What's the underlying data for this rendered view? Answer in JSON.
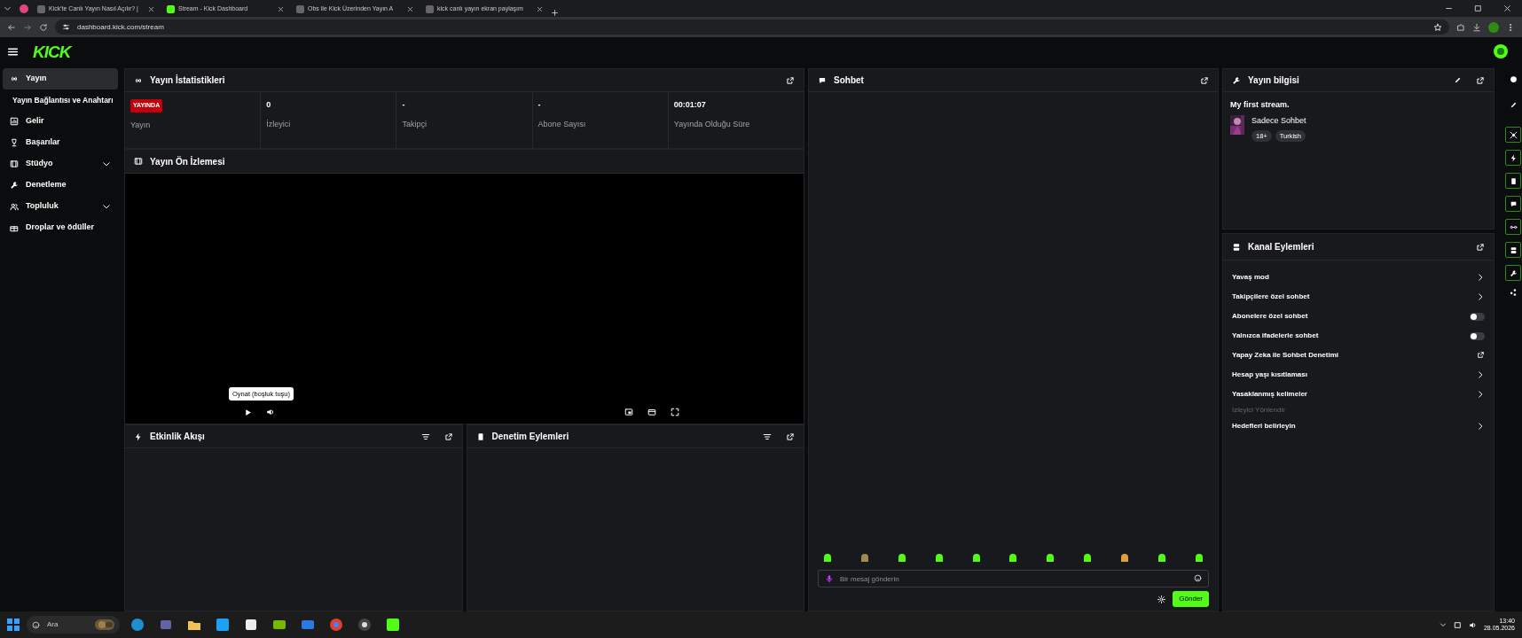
{
  "browser": {
    "tabs": [
      {
        "title": "Kick'te Canlı Yayın Nasıl Açılır? |",
        "selected": false
      },
      {
        "title": "Stream - Kick Dashboard",
        "selected": true
      },
      {
        "title": "Obs ile Kick Üzerinden Yayın A",
        "selected": false
      },
      {
        "title": "kick canlı yayın ekran paylaşım",
        "selected": false
      }
    ],
    "address": "dashboard.kick.com/stream"
  },
  "header": {
    "logo": "KICK"
  },
  "sidebar": {
    "items": [
      {
        "label": "Yayın",
        "kind": "item",
        "selected": true
      },
      {
        "label": "Yayın Bağlantısı ve Anahtarı",
        "kind": "subitem",
        "selected": false
      },
      {
        "label": "Gelir",
        "kind": "item",
        "selected": false
      },
      {
        "label": "Başarılar",
        "kind": "item",
        "selected": false
      },
      {
        "label": "Stüdyo",
        "kind": "group",
        "selected": false
      },
      {
        "label": "Denetleme",
        "kind": "item",
        "selected": false
      },
      {
        "label": "Topluluk",
        "kind": "group",
        "selected": false
      },
      {
        "label": "Droplar ve ödüller",
        "kind": "item",
        "selected": false
      }
    ]
  },
  "stats": {
    "title": "Yayın İstatistikleri",
    "cells": [
      {
        "kind": "badge",
        "value": "YAYINDA",
        "label": "Yayın"
      },
      {
        "kind": "text",
        "value": "0",
        "label": "İzleyici"
      },
      {
        "kind": "text",
        "value": "-",
        "label": "Takipçi"
      },
      {
        "kind": "text",
        "value": "-",
        "label": "Abone Sayısı"
      },
      {
        "kind": "text",
        "value": "00:01:07",
        "label": "Yayında Olduğu Süre"
      }
    ]
  },
  "preview": {
    "title": "Yayın Ön İzlemesi",
    "tooltip": "Oynat (boşluk tuşu)"
  },
  "activity_feed": {
    "title": "Etkinlik Akışı"
  },
  "mod_actions": {
    "title": "Denetim Eylemleri"
  },
  "chat": {
    "title": "Sohbet",
    "placeholder": "Bir mesaj gönderin",
    "send": "Gönder"
  },
  "stream_info": {
    "title": "Yayın bilgisi",
    "stream_title": "My first stream.",
    "category": "Sadece Sohbet",
    "tags": [
      "18+",
      "Turkish"
    ]
  },
  "channel_actions": {
    "title": "Kanal Eylemleri",
    "items": [
      {
        "label": "Yavaş mod",
        "kind": "chevron"
      },
      {
        "label": "Takipçilere özel sohbet",
        "kind": "chevron"
      },
      {
        "label": "Abonelere özel sohbet",
        "kind": "toggle",
        "on": false
      },
      {
        "label": "Yalnızca ifadelerle sohbet",
        "kind": "toggle",
        "on": false
      },
      {
        "label": "Yapay Zeka ile Sohbet Denetimi",
        "kind": "external"
      },
      {
        "label": "Hesap yaşı kısıtlaması",
        "kind": "chevron"
      },
      {
        "label": "Yasaklanmış kelimeler",
        "kind": "chevron"
      },
      {
        "label": "İzleyici Yönlendir",
        "kind": "heading"
      },
      {
        "label": "Hedefleri belirleyin",
        "kind": "chevron"
      }
    ]
  },
  "taskbar": {
    "search_placeholder": "Ara",
    "time": "13:40",
    "date": "28.05.2026"
  }
}
